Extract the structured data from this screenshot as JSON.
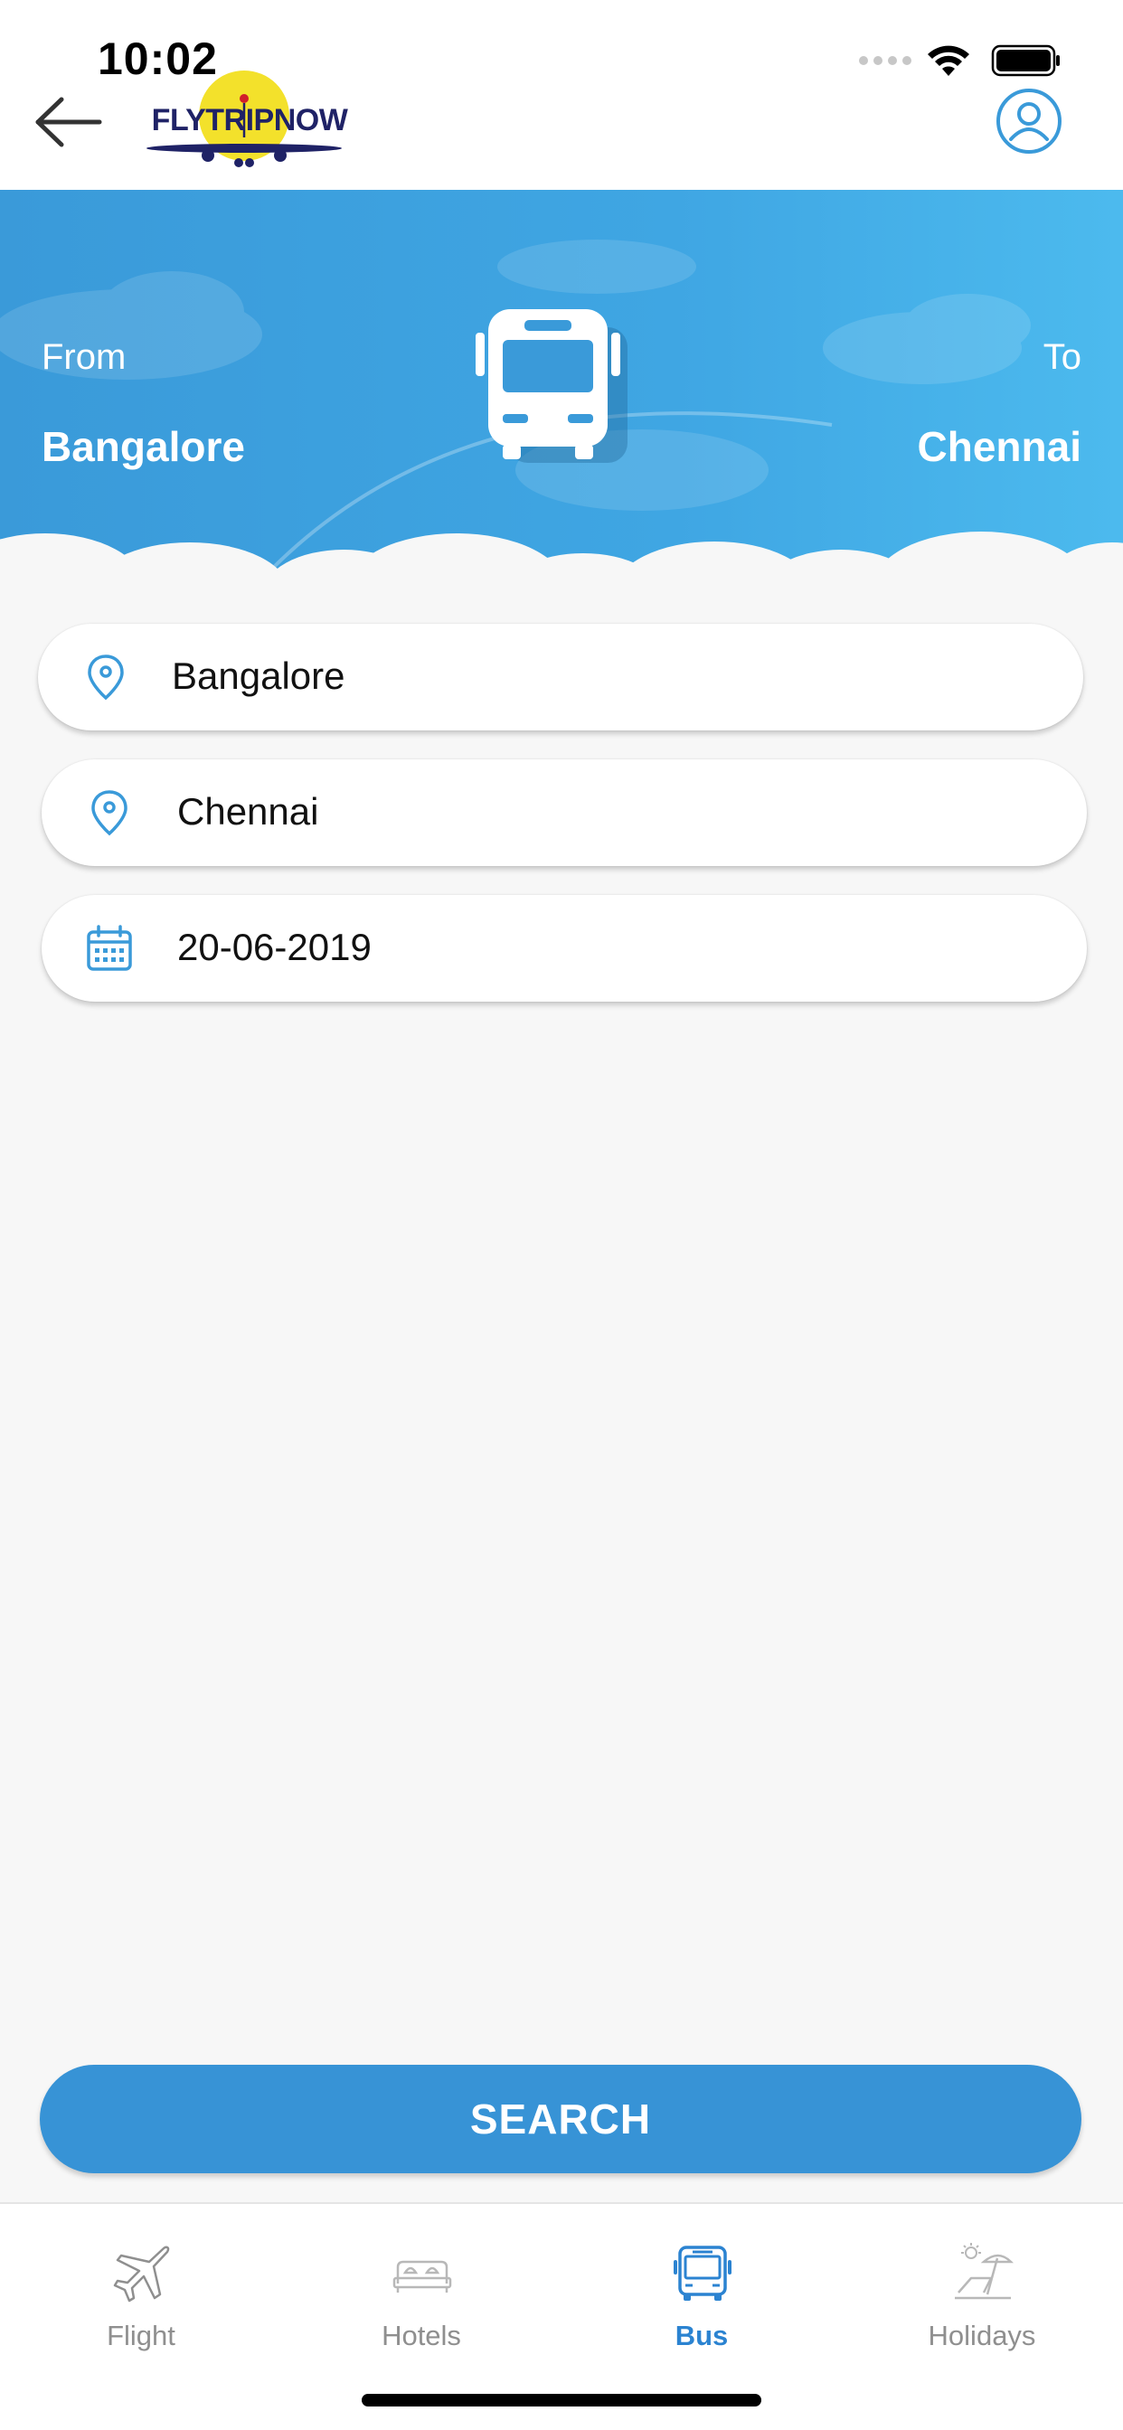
{
  "status_bar": {
    "time": "10:02"
  },
  "header": {
    "logo_text": "FLYTRIPNOW",
    "back_icon": "arrow-left-icon",
    "profile_icon": "user-circle-icon"
  },
  "hero": {
    "from_label": "From",
    "from_city": "Bangalore",
    "to_label": "To",
    "to_city": "Chennai",
    "illustration_icon": "bus-icon"
  },
  "form": {
    "from_value": "Bangalore",
    "to_value": "Chennai",
    "date_value": "20-06-2019",
    "from_icon": "location-pin-icon",
    "to_icon": "location-pin-icon",
    "date_icon": "calendar-icon"
  },
  "search_button": {
    "label": "SEARCH"
  },
  "bottom_nav": {
    "items": [
      {
        "label": "Flight",
        "icon": "plane-icon",
        "active": false
      },
      {
        "label": "Hotels",
        "icon": "bed-icon",
        "active": false
      },
      {
        "label": "Bus",
        "icon": "bus-icon",
        "active": true
      },
      {
        "label": "Holidays",
        "icon": "beach-chair-icon",
        "active": false
      }
    ]
  },
  "colors": {
    "accent": "#3793d6",
    "hero_gradient_start": "#3a9ad9",
    "hero_gradient_end": "#4cbaee",
    "active_tab": "#2b83d1",
    "inactive_tab": "#8f8f8f",
    "logo_sun": "#f3e12b",
    "logo_text": "#1f2266"
  }
}
